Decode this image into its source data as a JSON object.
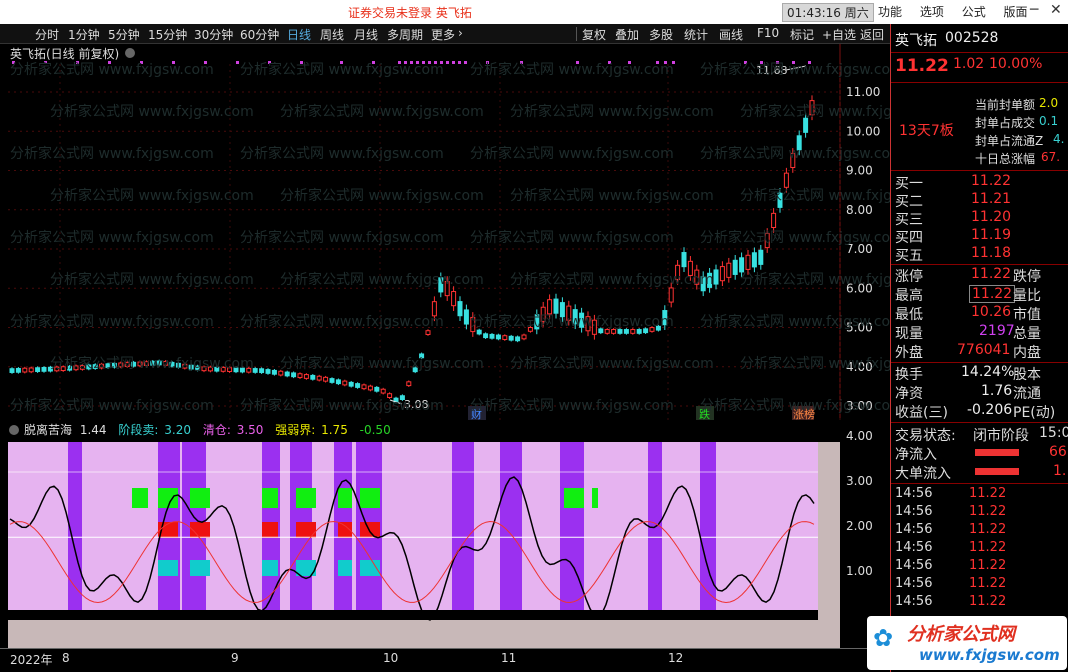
{
  "titlebar": {
    "status": "证券交易未登录  英飞拓",
    "clock": "01:43:16 周六",
    "menus": [
      "功能",
      "选项",
      "公式",
      "版面"
    ]
  },
  "toolbar": {
    "periods": [
      "分时",
      "1分钟",
      "5分钟",
      "15分钟",
      "30分钟",
      "60分钟",
      "日线",
      "周线",
      "月线",
      "多周期",
      "更多"
    ],
    "active": "日线",
    "actions": [
      "复权",
      "叠加",
      "多股",
      "统计",
      "画线",
      "F10",
      "标记",
      "+自选",
      "返回"
    ]
  },
  "chart_header": {
    "title": "英飞拓(日线 前复权)"
  },
  "price_axis": [
    "11.00",
    "10.00",
    "9.00",
    "8.00",
    "7.00",
    "6.00",
    "5.00",
    "4.00",
    "3.00"
  ],
  "ind_axis": [
    "4.00",
    "3.00",
    "2.00",
    "1.00"
  ],
  "annotations": {
    "high_label": "11.68",
    "low_label": "3.08"
  },
  "event_markers": [
    "财",
    "跌",
    "涨榜"
  ],
  "indicator": {
    "name": "脱离苦海",
    "value1": "1.44",
    "label_stage": "阶段卖:",
    "stage_value": "3.20",
    "label_clear": "清仓:",
    "clear_value": "3.50",
    "label_strong": "强弱界:",
    "strong_value": "1.75",
    "neg_value": "-0.50"
  },
  "time_axis": [
    "2022年",
    "8",
    "9",
    "10",
    "11",
    "12"
  ],
  "quote": {
    "name": "英飞拓",
    "code": "002528",
    "price": "11.22",
    "change": "1.02",
    "change_pct": "10.00%",
    "streak": "13天7板",
    "seal_labels": [
      "当前封单额",
      "封单占成交",
      "封单占流通Z",
      "十日总涨幅"
    ],
    "seal_values": [
      "2.0",
      "0.1",
      "4.",
      "67."
    ],
    "bids": [
      {
        "label": "买一",
        "price": "11.22"
      },
      {
        "label": "买二",
        "price": "11.21"
      },
      {
        "label": "买三",
        "price": "11.20"
      },
      {
        "label": "买四",
        "price": "11.19"
      },
      {
        "label": "买五",
        "price": "11.18"
      }
    ],
    "stats": [
      {
        "l1": "涨停",
        "v1": "11.22",
        "l2": "跌停"
      },
      {
        "l1": "最高",
        "v1": "11.22",
        "l2": "量比"
      },
      {
        "l1": "最低",
        "v1": "10.26",
        "l2": "市值"
      },
      {
        "l1": "现量",
        "v1": "2197",
        "l2": "总量"
      },
      {
        "l1": "外盘",
        "v1": "776041",
        "l2": "内盘"
      }
    ],
    "stats2": [
      {
        "l1": "换手",
        "v1": "14.24%",
        "l2": "股本"
      },
      {
        "l1": "净资",
        "v1": "1.76",
        "l2": "流通"
      },
      {
        "l1": "收益(三)",
        "v1": "-0.206",
        "l2": "PE(动)"
      }
    ],
    "trade_status_label": "交易状态:",
    "trade_status": "闭市阶段",
    "trade_time": "15:0",
    "netflow_label": "净流入",
    "netflow_value": "66",
    "bigflow_label": "大单流入",
    "bigflow_value": "1.",
    "ticks": [
      {
        "time": "14:56",
        "price": "11.22"
      },
      {
        "time": "14:56",
        "price": "11.22"
      },
      {
        "time": "14:56",
        "price": "11.22"
      },
      {
        "time": "14:56",
        "price": "11.22"
      },
      {
        "time": "14:56",
        "price": "11.22"
      },
      {
        "time": "14:56",
        "price": "11.22"
      },
      {
        "time": "14:56",
        "price": "11.22"
      }
    ]
  },
  "watermark": {
    "brand": "分析家公式网",
    "url": "www.fxjgsw.com"
  },
  "colors": {
    "up": "#ff3232",
    "down": "#38e0e0",
    "bg": "#000000",
    "indbg": "#e6b3f0",
    "purple": "#9b30f0",
    "green": "#11ee11"
  }
}
